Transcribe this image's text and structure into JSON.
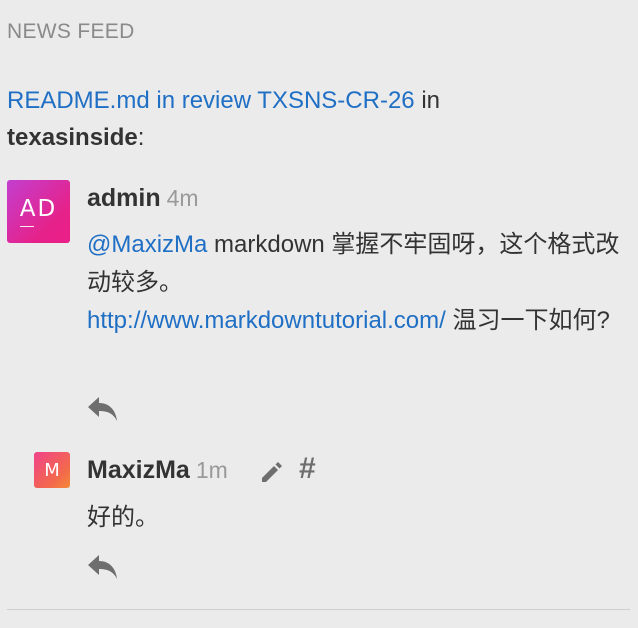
{
  "feed": {
    "header": "NEWS FEED",
    "title_link": "README.md in review TXSNS-CR-26",
    "title_in": " in ",
    "title_repo": "texasinside",
    "title_colon": ":"
  },
  "comments": [
    {
      "avatar_initials": "AD",
      "author": "admin",
      "time": "4m",
      "mention": "@MaxizMa",
      "text_a": " markdown 掌握不牢固呀，这个格式改动较多。",
      "link": "http://www.markdowntutorial.com/",
      "text_b": " 温习一下如何?",
      "icons": [
        "reply-icon"
      ]
    },
    {
      "avatar_initials": "M",
      "author": "MaxizMa",
      "time": "1m",
      "text": "好的。",
      "hash_symbol": "#",
      "icons": [
        "pencil-icon",
        "hash-icon",
        "reply-icon"
      ]
    }
  ],
  "colors": {
    "background": "#ebebeb",
    "link": "#1f6fc5",
    "muted": "#9a9a9a",
    "avatar_admin": "#e6228a",
    "avatar_maxizma": "#f36a4a"
  }
}
